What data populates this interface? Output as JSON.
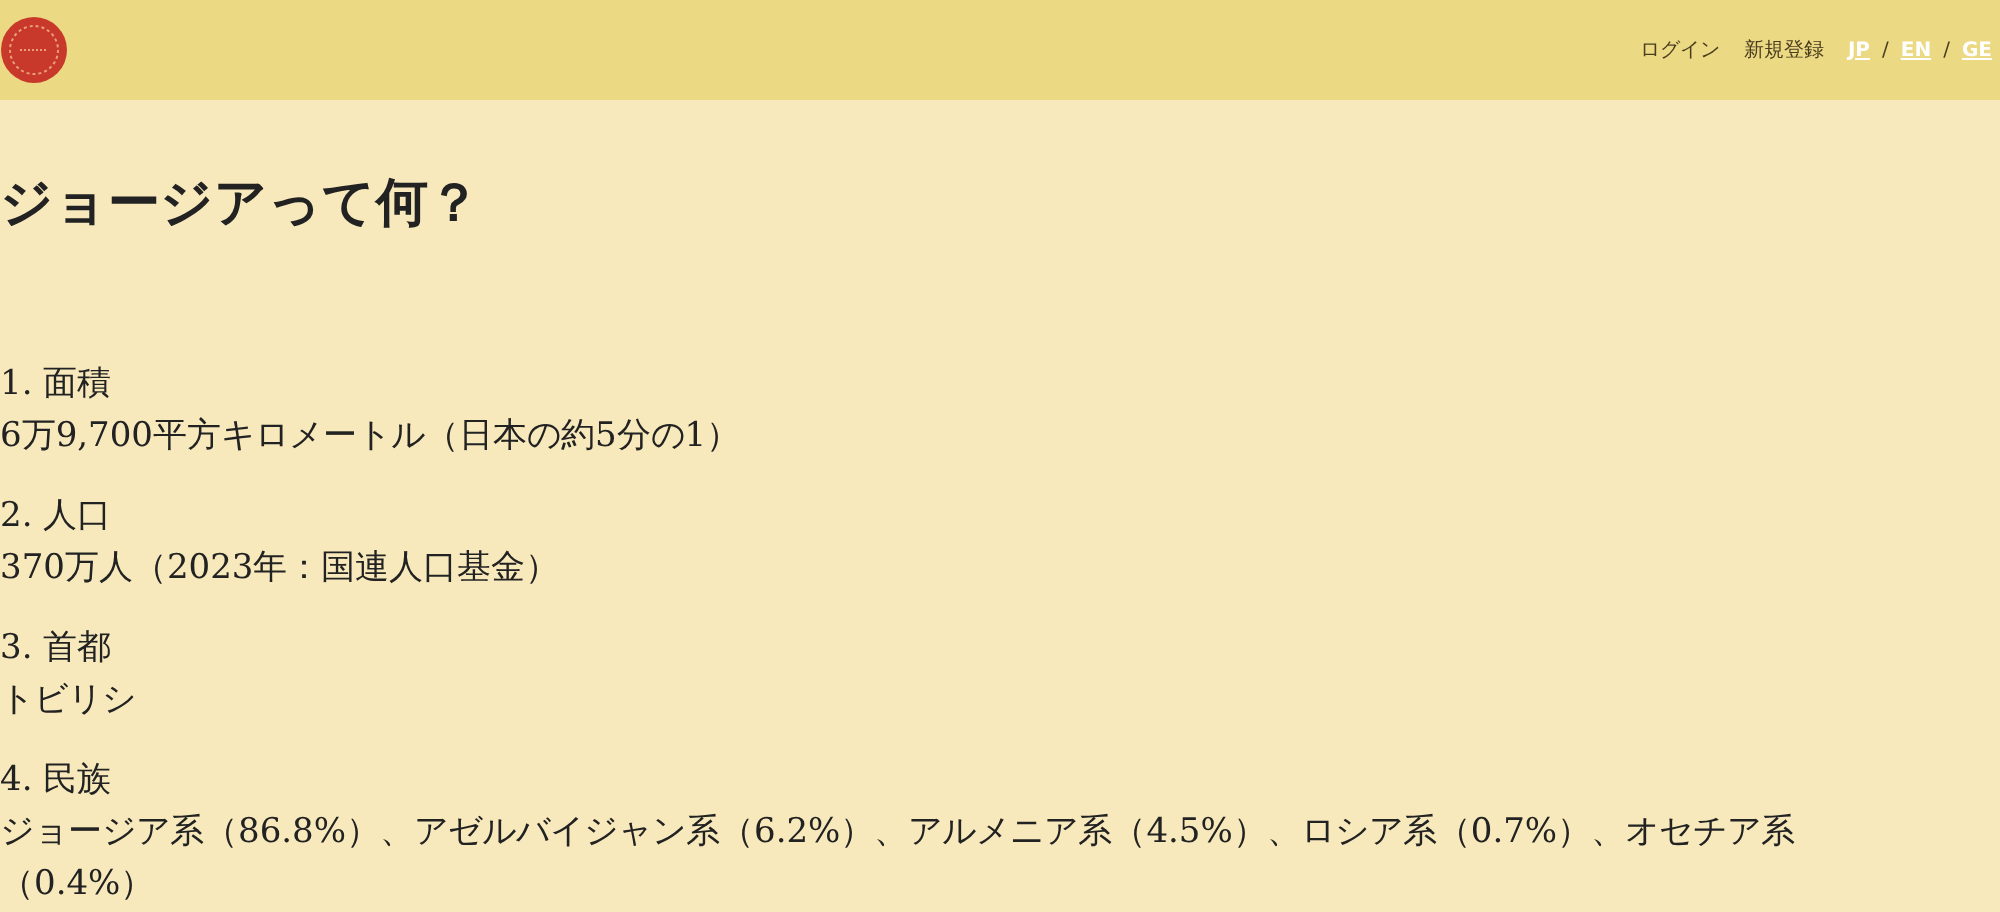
{
  "header": {
    "nav": [
      "ログイン",
      "新規登録"
    ],
    "languages": [
      "JP",
      "EN",
      "GE"
    ],
    "separator": "/"
  },
  "title": "ジョージアって何？",
  "sections": [
    {
      "heading": "1. 面積",
      "body": "6万9,700平方キロメートル（日本の約5分の1）"
    },
    {
      "heading": "2. 人口",
      "body": "370万人（2023年：国連人口基金）"
    },
    {
      "heading": "3. 首都",
      "body": "トビリシ"
    },
    {
      "heading": "4. 民族",
      "body": "ジョージア系（86.8%）、アゼルバイジャン系（6.2%）、アルメニア系（4.5%）、ロシア系（0.7%）、オセチア系（0.4%）"
    }
  ]
}
